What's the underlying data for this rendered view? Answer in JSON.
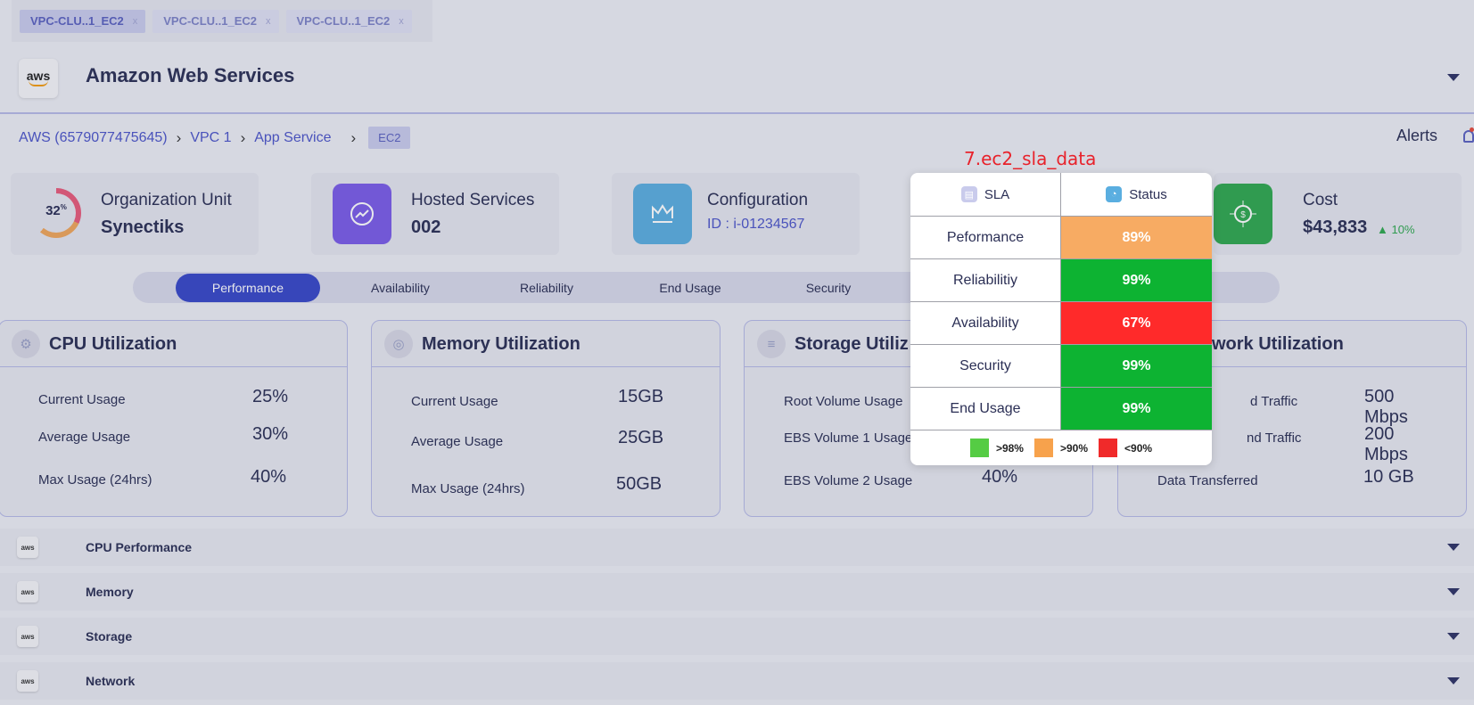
{
  "tabs": [
    {
      "label": "VPC-CLU..1_EC2",
      "close": "x"
    },
    {
      "label": "VPC-CLU..1_EC2",
      "close": "x"
    },
    {
      "label": "VPC-CLU..1_EC2",
      "close": "x"
    }
  ],
  "header": {
    "logo_text": "aws",
    "title": "Amazon Web Services"
  },
  "breadcrumb": {
    "items": [
      "AWS (6579077475645)",
      "VPC 1",
      "App Service"
    ],
    "current": "EC2",
    "alerts_label": "Alerts"
  },
  "summary": {
    "org": {
      "label": "Organization Unit",
      "value": "Synectiks",
      "percent": "32",
      "percent_sup": "%"
    },
    "hosted": {
      "label": "Hosted Services",
      "value": "002"
    },
    "config": {
      "label": "Configuration",
      "id_text": "ID : i-01234567"
    },
    "cost": {
      "label": "Cost",
      "value": "$43,833",
      "change": "10%"
    }
  },
  "metric_tabs": [
    "Performance",
    "Availability",
    "Reliability",
    "End Usage",
    "Security"
  ],
  "utilization": [
    {
      "title": "CPU Utilization",
      "rows": [
        {
          "label": "Current Usage",
          "value": "25%"
        },
        {
          "label": "Average Usage",
          "value": "30%"
        },
        {
          "label": "Max Usage (24hrs)",
          "value": "40%"
        }
      ]
    },
    {
      "title": "Memory Utilization",
      "rows": [
        {
          "label": "Current Usage",
          "value": "15GB"
        },
        {
          "label": "Average Usage",
          "value": "25GB"
        },
        {
          "label": "Max Usage (24hrs)",
          "value": "50GB"
        }
      ]
    },
    {
      "title": "Storage Utiliz",
      "rows": [
        {
          "label": "Root Volume Usage",
          "value": ""
        },
        {
          "label": "EBS Volume 1 Usage",
          "value": ""
        },
        {
          "label": "EBS Volume 2 Usage",
          "value": "40%"
        }
      ]
    },
    {
      "title": "work Utilization",
      "rows": [
        {
          "label": "d Traffic",
          "value": "500 Mbps"
        },
        {
          "label": "nd Traffic",
          "value": "200 Mbps"
        },
        {
          "label": "Data Transferred",
          "value": "10 GB"
        }
      ]
    }
  ],
  "accordion": [
    {
      "logo": "aws",
      "label": "CPU Performance"
    },
    {
      "logo": "aws",
      "label": "Memory"
    },
    {
      "logo": "aws",
      "label": "Storage"
    },
    {
      "logo": "aws",
      "label": "Network"
    }
  ],
  "overlay": {
    "caption": "7.ec2_sla_data",
    "headers": {
      "sla": "SLA",
      "status": "Status"
    },
    "rows": [
      {
        "name": "Peformance",
        "value": "89%",
        "color": "#f7ab63"
      },
      {
        "name": "Reliabilitiy",
        "value": "99%",
        "color": "#0db332"
      },
      {
        "name": "Availability",
        "value": "67%",
        "color": "#ff2a2a"
      },
      {
        "name": "Security",
        "value": "99%",
        "color": "#0db332"
      },
      {
        "name": "End Usage",
        "value": "99%",
        "color": "#0db332"
      }
    ],
    "legend": [
      {
        "label": ">98%",
        "color": "#55cc44"
      },
      {
        "label": ">90%",
        "color": "#f7a24c"
      },
      {
        "label": "<90%",
        "color": "#f02a2a"
      }
    ]
  },
  "colors": {
    "accent": "#3747c8",
    "hosted_tile": "#7a5ce8",
    "config_tile": "#5aaee0",
    "cost_tile": "#2fa84f"
  }
}
